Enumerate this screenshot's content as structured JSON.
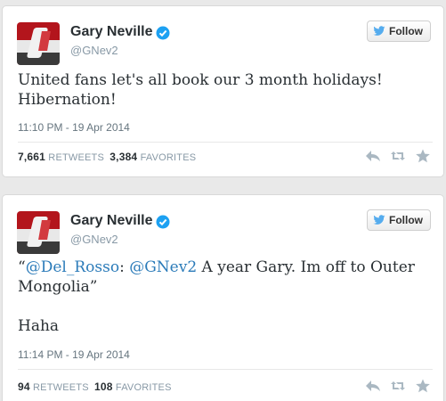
{
  "tweets": [
    {
      "name": "Gary Neville",
      "handle": "@GNev2",
      "follow_label": "Follow",
      "text_line1": "United fans let's all book our 3 month holidays!",
      "text_line2": "Hibernation!",
      "time": "11:10 PM - 19 Apr 2014",
      "retweets": "7,661",
      "retweets_label": "RETWEETS",
      "favorites": "3,384",
      "favorites_label": "FAVORITES",
      "avatar_text": "MINUTE OF EDUARDO"
    },
    {
      "name": "Gary Neville",
      "handle": "@GNev2",
      "follow_label": "Follow",
      "quote_open": "“",
      "mention1": "@Del_Rosso",
      "colon": ": ",
      "mention2": "@GNev2",
      "text_rest1": " A year Gary. Im off to Outer",
      "text_line2": "Mongolia”",
      "text_line3": "Haha",
      "time": "11:14 PM - 19 Apr 2014",
      "retweets": "94",
      "retweets_label": "RETWEETS",
      "favorites": "108",
      "favorites_label": "FAVORITES",
      "avatar_text": "MINUTE OF EDUARDO"
    }
  ],
  "colors": {
    "link": "#2b7bb9",
    "verified": "#1da1f2",
    "twitter_blue": "#55acee",
    "text": "#292f33",
    "meta": "#8899a6"
  },
  "icons": {
    "verified": "verified-badge-icon",
    "bird": "twitter-bird-icon",
    "reply": "reply-icon",
    "retweet": "retweet-icon",
    "favorite": "star-icon"
  }
}
